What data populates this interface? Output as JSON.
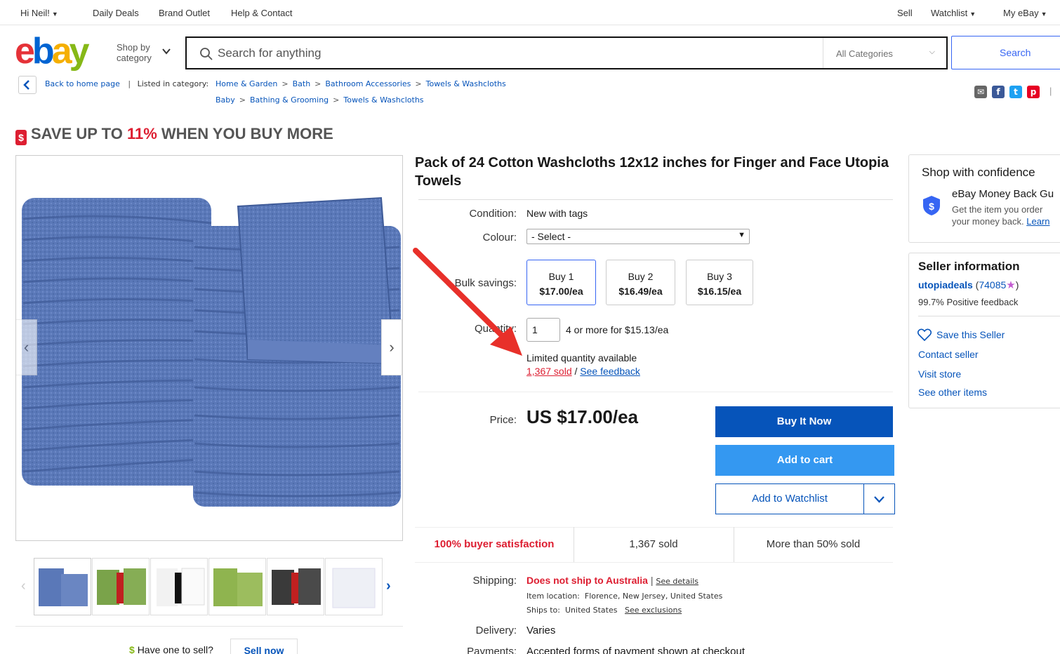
{
  "topnav": {
    "greeting": "Hi Neil!",
    "links": [
      "Daily Deals",
      "Brand Outlet",
      "Help & Contact"
    ],
    "right": [
      "Sell",
      "Watchlist",
      "My eBay"
    ]
  },
  "header": {
    "logo_text": "ebay",
    "shop_by_line1": "Shop by",
    "shop_by_line2": "category",
    "search_placeholder": "Search for anything",
    "category_select": "All Categories",
    "search_button": "Search"
  },
  "breadcrumb": {
    "back_label": "Back to home page",
    "listed_label": "Listed in category:",
    "path1": [
      "Home & Garden",
      "Bath",
      "Bathroom Accessories",
      "Towels & Washcloths"
    ],
    "path2": [
      "Baby",
      "Bathing & Grooming",
      "Towels & Washcloths"
    ]
  },
  "banner": {
    "icon": "$",
    "prefix": "SAVE UP TO ",
    "percent": "11%",
    "suffix": " WHEN YOU BUY MORE"
  },
  "gallery": {
    "thumbnails": [
      "blue-towels",
      "green-towels",
      "white-towels",
      "green-stack",
      "black-towels",
      "white-stack"
    ]
  },
  "item": {
    "title": "Pack of 24 Cotton Washcloths 12x12 inches for Finger and Face Utopia Towels",
    "condition_label": "Condition:",
    "condition_value": "New with tags",
    "colour_label": "Colour:",
    "colour_value": "- Select -",
    "bulk_label": "Bulk savings:",
    "bulk": [
      {
        "qty": "Buy 1",
        "price": "$17.00/ea"
      },
      {
        "qty": "Buy 2",
        "price": "$16.49/ea"
      },
      {
        "qty": "Buy 3",
        "price": "$16.15/ea"
      }
    ],
    "quantity_label": "Quantity:",
    "quantity_value": "1",
    "quantity_note": "4 or more for $15.13/ea",
    "availability": "Limited quantity available",
    "sold_link": "1,367 sold",
    "slash": " / ",
    "feedback_link": "See feedback",
    "price_label": "Price:",
    "price": "US $17.00/ea",
    "buy_now": "Buy It Now",
    "add_cart": "Add to cart",
    "add_watchlist": "Add to Watchlist"
  },
  "stats": {
    "satisfaction": "100% buyer satisfaction",
    "sold": "1,367 sold",
    "more": "More than 50% sold"
  },
  "shipping": {
    "label": "Shipping:",
    "value": "Does not ship to Australia",
    "sep": " | ",
    "details": "See details",
    "location_label": "Item location:",
    "location": "Florence, New Jersey, United States",
    "ships_to_label": "Ships to:",
    "ships_to": "United States",
    "exclusions": "See exclusions",
    "delivery_label": "Delivery:",
    "delivery_value": "Varies",
    "payments_label": "Payments:",
    "payments_value": "Accepted forms of payment shown at checkout"
  },
  "sell": {
    "text": "Have one to sell?",
    "link": "Sell now"
  },
  "confidence": {
    "title": "Shop with confidence",
    "guarantee_title": "eBay Money Back Gu",
    "guarantee_line1": "Get the item you order",
    "guarantee_line2": "your money back.",
    "learn": "Learn"
  },
  "seller": {
    "title": "Seller information",
    "name": "utopiadeals",
    "score": "74085",
    "positive": "99.7% Positive feedback",
    "save": "Save this Seller",
    "contact": "Contact seller",
    "visit": "Visit store",
    "other": "See other items"
  },
  "colors": {
    "ebay_red": "#e53238",
    "ebay_blue": "#0064d2",
    "ebay_yellow": "#f5af02",
    "ebay_green": "#86b817",
    "link": "#0654ba",
    "alert_red": "#dd1e31"
  }
}
